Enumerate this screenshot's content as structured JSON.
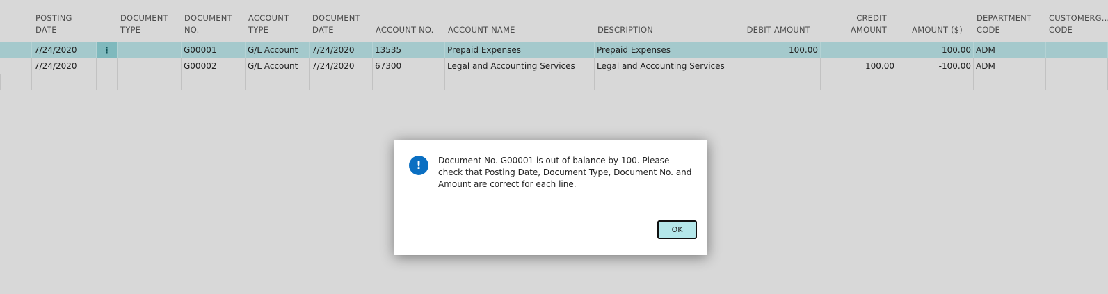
{
  "columns": [
    {
      "key": "posting_date",
      "label": "Posting\nDate"
    },
    {
      "key": "document_type",
      "label": "Document\nType"
    },
    {
      "key": "document_no",
      "label": "Document\nNo."
    },
    {
      "key": "account_type",
      "label": "Account\nType"
    },
    {
      "key": "document_date",
      "label": "Document\nDate"
    },
    {
      "key": "account_no",
      "label": "Account No."
    },
    {
      "key": "account_name",
      "label": "Account Name"
    },
    {
      "key": "description",
      "label": "Description"
    },
    {
      "key": "debit_amount",
      "label": "Debit Amount"
    },
    {
      "key": "credit_amount",
      "label": "Credit\nAmount"
    },
    {
      "key": "amount",
      "label": "Amount ($)"
    },
    {
      "key": "department_code",
      "label": "Department\nCode"
    },
    {
      "key": "customergroup_code",
      "label": "Customerg...\nCode"
    }
  ],
  "rows": [
    {
      "posting_date": "7/24/2020",
      "document_type": "",
      "document_no": "G00001",
      "account_type": "G/L Account",
      "document_date": "7/24/2020",
      "account_no": "13535",
      "account_name": "Prepaid Expenses",
      "description": "Prepaid Expenses",
      "debit_amount": "100.00",
      "credit_amount": "",
      "amount": "100.00",
      "department_code": "ADM",
      "customergroup_code": "",
      "selected": true
    },
    {
      "posting_date": "7/24/2020",
      "document_type": "",
      "document_no": "G00002",
      "account_type": "G/L Account",
      "document_date": "7/24/2020",
      "account_no": "67300",
      "account_name": "Legal and Accounting Services",
      "description": "Legal and Accounting Services",
      "debit_amount": "",
      "credit_amount": "100.00",
      "amount": "-100.00",
      "department_code": "ADM",
      "customergroup_code": "",
      "selected": false
    }
  ],
  "row_menu_icon": "more-vertical-icon",
  "dialog": {
    "icon": "info-icon",
    "icon_glyph": "!",
    "message": "Document No. G00001 is out of balance by 100. Please check that Posting Date, Document Type, Document No. and Amount are correct for each line.",
    "ok_label": "OK",
    "accent": "#0a6fc2"
  }
}
